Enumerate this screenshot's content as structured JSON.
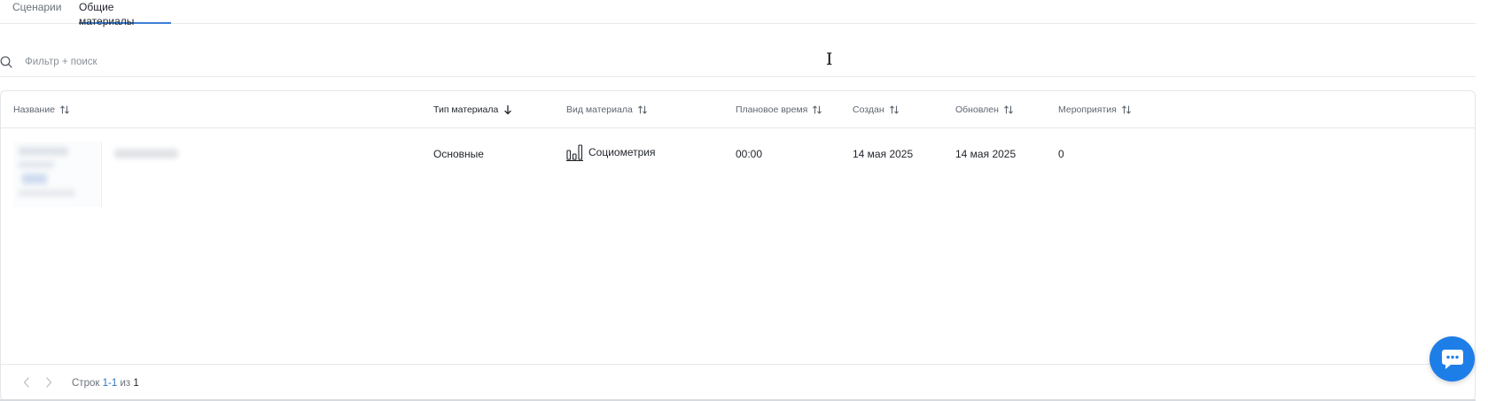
{
  "tabs": [
    {
      "label": "Сценарии",
      "active": false
    },
    {
      "label": "Общие материалы",
      "active": true
    }
  ],
  "search": {
    "placeholder": "Фильтр + поиск",
    "value": ""
  },
  "table": {
    "columns": {
      "name": "Название",
      "material_type": "Тип материала",
      "material_kind": "Вид материала",
      "planned_time": "Плановое время",
      "created": "Создан",
      "updated": "Обновлен",
      "events": "Мероприятия"
    },
    "sorted_column": "material_type",
    "rows": [
      {
        "material_type": "Основные",
        "material_kind": "Социометрия",
        "material_kind_icon": "bar-chart-icon",
        "planned_time": "00:00",
        "created": "14 мая 2025",
        "updated": "14 мая 2025",
        "events": "0"
      }
    ]
  },
  "pagination": {
    "prefix": "Строк",
    "range": "1-1",
    "of_label": "из",
    "total": "1"
  },
  "colors": {
    "accent": "#3d7fd6",
    "chat_button": "#1e7ee8",
    "link": "#2f6fc9"
  }
}
